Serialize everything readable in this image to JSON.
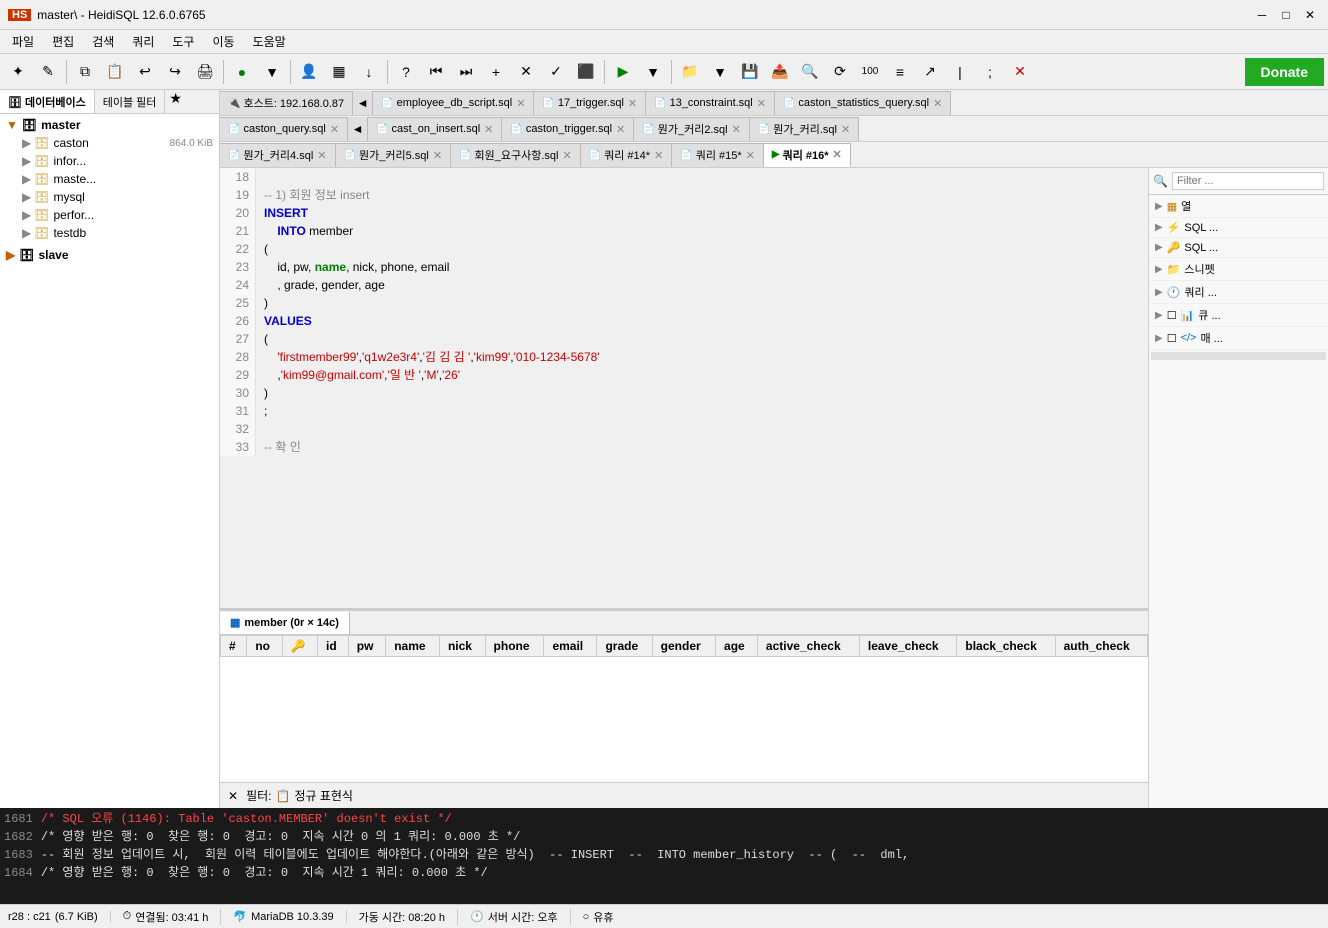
{
  "titlebar": {
    "title": "master\\ - HeidiSQL 12.6.0.6765",
    "logo": "HS"
  },
  "menubar": {
    "items": [
      "파일",
      "편집",
      "검색",
      "쿼리",
      "도구",
      "이동",
      "도움말"
    ]
  },
  "toolbar": {
    "donate_label": "Donate"
  },
  "sidebar": {
    "tabs": [
      "데이터베이스",
      "테이블 필터"
    ],
    "tree": [
      {
        "label": "master",
        "level": "root",
        "icon": "server",
        "expanded": true
      },
      {
        "label": "caston",
        "level": "child",
        "icon": "db",
        "badge": "864.0 KiB"
      },
      {
        "label": "infor...",
        "level": "child",
        "icon": "db",
        "badge": ""
      },
      {
        "label": "maste...",
        "level": "child",
        "icon": "db",
        "badge": ""
      },
      {
        "label": "mysql",
        "level": "child",
        "icon": "db",
        "badge": ""
      },
      {
        "label": "perfor...",
        "level": "child",
        "icon": "db",
        "badge": ""
      },
      {
        "label": "testdb",
        "level": "child",
        "icon": "db",
        "badge": ""
      },
      {
        "label": "slave",
        "level": "root",
        "icon": "server",
        "expanded": false
      }
    ]
  },
  "doc_tabs_row1": [
    {
      "label": "호스트: 192.168.0.87",
      "icon": "host",
      "active": false,
      "closeable": false
    },
    {
      "label": "employee_db_script.sql",
      "icon": "sql",
      "active": false,
      "closeable": true
    },
    {
      "label": "17_trigger.sql",
      "icon": "sql",
      "active": false,
      "closeable": true
    },
    {
      "label": "13_constraint.sql",
      "icon": "sql",
      "active": false,
      "closeable": true
    },
    {
      "label": "caston_statistics_query.sql",
      "icon": "sql",
      "active": false,
      "closeable": true
    }
  ],
  "doc_tabs_row2": [
    {
      "label": "caston_query.sql",
      "icon": "sql",
      "active": false,
      "closeable": true
    },
    {
      "label": "cast_on_insert.sql",
      "icon": "sql",
      "active": false,
      "closeable": true
    },
    {
      "label": "caston_trigger.sql",
      "icon": "sql",
      "active": false,
      "closeable": true
    },
    {
      "label": "뭔가_커리2.sql",
      "icon": "sql",
      "active": false,
      "closeable": true
    },
    {
      "label": "뭔가_커리.sql",
      "icon": "sql",
      "active": false,
      "closeable": true
    }
  ],
  "doc_tabs_row3": [
    {
      "label": "뭔가_커리4.sql",
      "icon": "sql",
      "active": false,
      "closeable": true
    },
    {
      "label": "뭔가_커리5.sql",
      "icon": "sql",
      "active": false,
      "closeable": true
    },
    {
      "label": "회원_요구사항.sql",
      "icon": "sql",
      "active": false,
      "closeable": true
    },
    {
      "label": "쿼리 #14*",
      "icon": "sql",
      "active": false,
      "closeable": true
    },
    {
      "label": "쿼리 #15*",
      "icon": "sql",
      "active": false,
      "closeable": true
    },
    {
      "label": "쿼리 #16*",
      "icon": "run",
      "active": true,
      "closeable": true
    }
  ],
  "code_lines": [
    {
      "num": "18",
      "content": ""
    },
    {
      "num": "19",
      "content": "-- 1) 회원 정보 insert",
      "type": "comment"
    },
    {
      "num": "20",
      "content": "INSERT",
      "type": "keyword"
    },
    {
      "num": "21",
      "content": "    INTO member",
      "type": "mixed"
    },
    {
      "num": "22",
      "content": "(",
      "type": "normal"
    },
    {
      "num": "23",
      "content": "    id, pw, name, nick, phone, email",
      "type": "columns"
    },
    {
      "num": "24",
      "content": "    , grade, gender, age",
      "type": "columns"
    },
    {
      "num": "25",
      "content": ")",
      "type": "normal"
    },
    {
      "num": "26",
      "content": "VALUES",
      "type": "keyword"
    },
    {
      "num": "27",
      "content": "(",
      "type": "normal"
    },
    {
      "num": "28",
      "content": "    'firstmember99','q1w2e3r4','김 김 김 ','kim99','010-1234-5678'",
      "type": "strings"
    },
    {
      "num": "29",
      "content": "    ,'kim99@gmail.com','일 반 ','M','26'",
      "type": "strings"
    },
    {
      "num": "30",
      "content": ")",
      "type": "normal"
    },
    {
      "num": "31",
      "content": ";",
      "type": "normal"
    },
    {
      "num": "32",
      "content": ""
    },
    {
      "num": "33",
      "content": "-- 확 인",
      "type": "comment"
    }
  ],
  "right_side_panel": {
    "filter_placeholder": "Filter ...",
    "items": [
      {
        "label": "열",
        "icon": "grid"
      },
      {
        "label": "SQL ...",
        "icon": "lightning"
      },
      {
        "label": "SQL ...",
        "icon": "key"
      },
      {
        "label": "스니펫",
        "icon": "folder"
      },
      {
        "label": "쿼리 ...",
        "icon": "clock"
      },
      {
        "label": "큐 ...",
        "icon": "chart"
      },
      {
        "label": "매 ...",
        "icon": "code"
      }
    ]
  },
  "result_tab": {
    "label": "member (0r × 14c)",
    "icon": "table"
  },
  "result_columns": [
    "#",
    "no",
    "",
    "id",
    "pw",
    "name",
    "nick",
    "phone",
    "email",
    "grade",
    "gender",
    "age",
    "active_check",
    "leave_check",
    "black_check",
    "auth_check"
  ],
  "filter_bottom": {
    "label": "필터:",
    "value": "정규 표현식"
  },
  "log_lines": [
    {
      "num": "1681",
      "text": "/* SQL 오류 (1146): Table 'caston.MEMBER' doesn't exist */",
      "type": "error"
    },
    {
      "num": "1682",
      "text": "/* 영향 받은 행: 0  찾은 행: 0  경고: 0  지속 시간 0 의 1 쿼리: 0.000 초 */",
      "type": "info"
    },
    {
      "num": "1683",
      "text": "-- 회원 정보 업데이트 시,  회원 이력 테이블에도 업데이트 해야한다.(아래와 같은 방식)  -- INSERT  --  INTO member_history  -- (  --  dml,",
      "type": "info"
    },
    {
      "num": "1684",
      "text": "/* 영향 받은 행: 0  찾은 행: 0  경고: 0  지속 시간 1 쿼리: 0.000 초 */",
      "type": "info"
    }
  ],
  "statusbar": {
    "row_col": "r28 : c21",
    "size": "(6.7 KiB)",
    "connection": "연결됨: 03:41 h",
    "db_engine": "MariaDB 10.3.39",
    "uptime": "가동 시간: 08:20 h",
    "server_time": "서버 시간: 오후",
    "status": "유휴"
  }
}
